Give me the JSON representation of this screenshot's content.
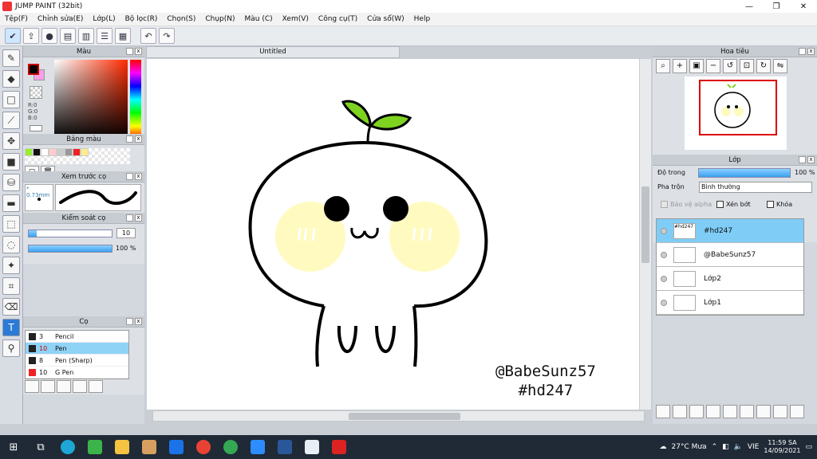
{
  "window": {
    "title": "JUMP PAINT (32bit)",
    "minimize": "—",
    "maximize": "❐",
    "close": "✕"
  },
  "menu": [
    "Tệp(F)",
    "Chỉnh sửa(E)",
    "Lớp(L)",
    "Bộ lọc(R)",
    "Chọn(S)",
    "Chụp(N)",
    "Màu (C)",
    "Xem(V)",
    "Công cụ(T)",
    "Cửa sổ(W)",
    "Help"
  ],
  "toolbar_icons": [
    "cloud-icon",
    "share-icon",
    "comment-icon",
    "document-icon",
    "page-icon",
    "properties-icon",
    "grid-icon",
    "undo-icon",
    "redo-icon"
  ],
  "color_panel": {
    "title": "Màu",
    "r": "R:0",
    "g": "G:0",
    "b": "B:0",
    "fg": "#000000",
    "bg": "#f8a0e8"
  },
  "palette_panel": {
    "title": "Bảng màu",
    "swatches": [
      "#99ee33",
      "#111111",
      "#ffffff",
      "#ffcccc",
      "#cccccc",
      "#999999",
      "#ee2222",
      "#ffee88"
    ],
    "dash": "---"
  },
  "brush_preview": {
    "title": "Xem trước cọ",
    "size": "* 0.73mm"
  },
  "brush_control": {
    "title": "Kiểm soát cọ",
    "size_value": "10",
    "opacity_value": "100 %",
    "size_fill": 0.1,
    "opacity_fill": 1.0
  },
  "brush_list": {
    "title": "Cọ",
    "items": [
      {
        "size": "3",
        "name": "Pencil",
        "color": "#222222",
        "selected": false
      },
      {
        "size": "10",
        "name": "Pen",
        "color": "#222222",
        "selected": true
      },
      {
        "size": "8",
        "name": "Pen (Sharp)",
        "color": "#222222",
        "selected": false
      },
      {
        "size": "10",
        "name": "G Pen",
        "color": "#ee2222",
        "selected": false
      }
    ]
  },
  "document": {
    "tab": "Untitled",
    "watermark_line1": "@BabeSunz57",
    "watermark_line2": "#hd247"
  },
  "navigator": {
    "title": "Hoa tiêu"
  },
  "layers_panel": {
    "title": "Lớp",
    "opacity_label": "Độ trong",
    "opacity_value": "100 %",
    "blend_label": "Pha trộn",
    "blend_value": "Bình thường",
    "protect_alpha": "Bảo vệ alpha",
    "clipping": "Xén bớt",
    "lock": "Khóa",
    "layers": [
      {
        "name": "#hd247",
        "thumb": "#hd247",
        "selected": true
      },
      {
        "name": "@BabeSunz57",
        "thumb": "",
        "selected": false
      },
      {
        "name": "Lớp2",
        "thumb": "",
        "selected": false
      },
      {
        "name": "Lớp1",
        "thumb": "",
        "selected": false
      }
    ]
  },
  "taskbar": {
    "weather": "27°C  Mưa",
    "lang": "VIE",
    "time": "11:59 SA",
    "date": "14/09/2021"
  }
}
